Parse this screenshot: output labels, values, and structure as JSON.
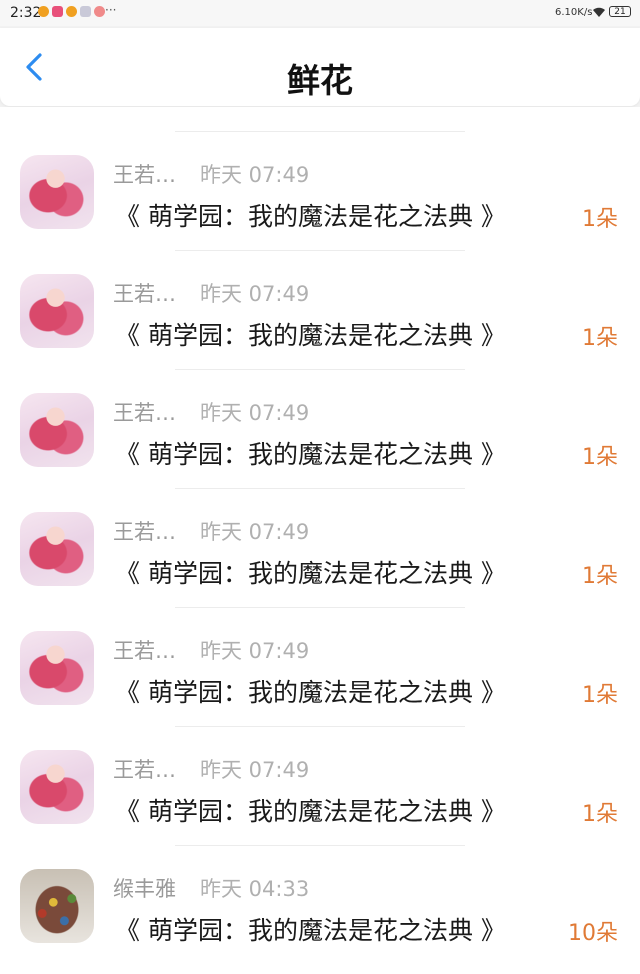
{
  "status_bar": {
    "time": "2:32",
    "notifications": [
      "weibo-icon",
      "mail-icon",
      "weibo-icon",
      "app-icon",
      "play-icon"
    ],
    "more": "···",
    "net_speed": "6.10K/s",
    "battery": "21"
  },
  "header": {
    "title": "鲜花"
  },
  "colors": {
    "accent_blue": "#2d8cf0",
    "count_orange": "#e07a36"
  },
  "gifts": [
    {
      "name": "王若…",
      "time": "昨天 07:49",
      "book": "《 萌学园：我的魔法是花之法典 》",
      "count": "1朵",
      "avatar": "anime-avatar"
    },
    {
      "name": "王若…",
      "time": "昨天 07:49",
      "book": "《 萌学园：我的魔法是花之法典 》",
      "count": "1朵",
      "avatar": "anime-avatar"
    },
    {
      "name": "王若…",
      "time": "昨天 07:49",
      "book": "《 萌学园：我的魔法是花之法典 》",
      "count": "1朵",
      "avatar": "anime-avatar"
    },
    {
      "name": "王若…",
      "time": "昨天 07:49",
      "book": "《 萌学园：我的魔法是花之法典 》",
      "count": "1朵",
      "avatar": "anime-avatar"
    },
    {
      "name": "王若…",
      "time": "昨天 07:49",
      "book": "《 萌学园：我的魔法是花之法典 》",
      "count": "1朵",
      "avatar": "anime-avatar"
    },
    {
      "name": "王若…",
      "time": "昨天 07:49",
      "book": "《 萌学园：我的魔法是花之法典 》",
      "count": "1朵",
      "avatar": "anime-avatar"
    },
    {
      "name": "缑丰雅",
      "time": "昨天 04:33",
      "book": "《 萌学园：我的魔法是花之法典 》",
      "count": "10朵",
      "avatar": "food-avatar"
    }
  ]
}
